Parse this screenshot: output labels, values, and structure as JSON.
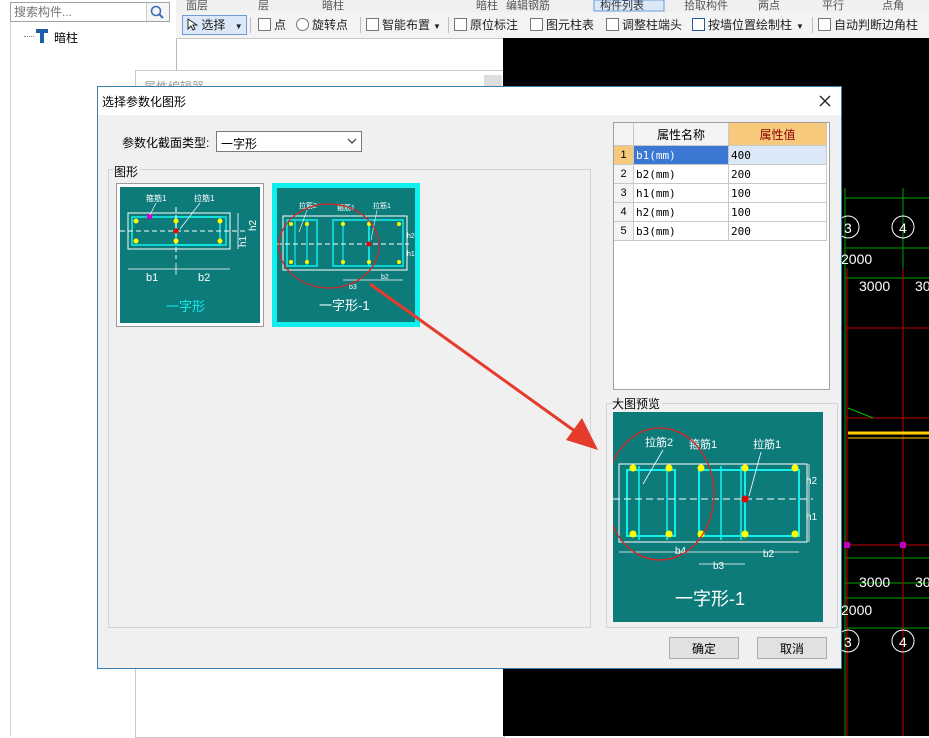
{
  "left_panel": {
    "search_placeholder": "搜索构件...",
    "tree_item": "暗柱",
    "icons": {
      "search": "search-icon",
      "tree": "column-icon"
    }
  },
  "toolbar_top": [
    "面层",
    "层",
    "暗柱",
    "暗柱",
    "编辑钢筋",
    "构件列表",
    "拾取构件",
    "两点",
    "平行",
    "点角"
  ],
  "toolbar": {
    "select": "选择",
    "point": "点",
    "rotate_point": "旋转点",
    "smart_layout": "智能布置",
    "origin_annotate": "原位标注",
    "element_table": "图元柱表",
    "adjust_column_end": "调整柱端头",
    "draw_by_wall": "按墙位置绘制柱",
    "auto_corner": "自动判断边角柱"
  },
  "attr_editor": {
    "title": "属性编辑器"
  },
  "dialog": {
    "title": "选择参数化图形",
    "section_type_label": "参数化截面类型:",
    "section_type_value": "一字形",
    "shapes_label": "图形",
    "preview_label": "大图预览",
    "ok": "确定",
    "cancel": "取消",
    "thumbnails": [
      {
        "name": "一字形",
        "labels": {
          "stirrup": "箍筋1",
          "tie": "拉筋1",
          "b1": "b1",
          "b2": "b2",
          "h1": "h1",
          "h2": "h2"
        }
      },
      {
        "name": "一字形-1",
        "labels": {
          "tie2": "拉筋2",
          "stirrup": "箍筋1",
          "tie": "拉筋1",
          "b3": "b3",
          "b2": "b2",
          "h1": "h1",
          "h2": "h2"
        }
      }
    ],
    "preview": {
      "name": "一字形-1",
      "labels": {
        "tie2": "拉筋2",
        "stirrup": "箍筋1",
        "tie": "拉筋1",
        "b3": "b3",
        "b2": "b2",
        "h1": "h1",
        "h2": "h2",
        "b4": "b4"
      }
    },
    "table": {
      "headers": [
        "属性名称",
        "属性值"
      ],
      "rows": [
        {
          "index": "1",
          "name": "b1(mm)",
          "value": "400"
        },
        {
          "index": "2",
          "name": "b2(mm)",
          "value": "200"
        },
        {
          "index": "3",
          "name": "h1(mm)",
          "value": "100"
        },
        {
          "index": "4",
          "name": "h2(mm)",
          "value": "100"
        },
        {
          "index": "5",
          "name": "b3(mm)",
          "value": "200"
        }
      ]
    }
  },
  "cad": {
    "axis_labels": [
      "3",
      "4",
      "3",
      "4"
    ],
    "dimensions": [
      "2000",
      "3000",
      "30",
      "3000",
      "30",
      "2000"
    ],
    "colors": {
      "background": "#000000",
      "grid_green": "#00a000",
      "grid_red": "#c00000",
      "yellow": "#ffd000"
    }
  },
  "colors": {
    "teal": "#0e7b7b",
    "cyan_bar": "#1eeeee",
    "header_orange": "#f7c97c",
    "selection_blue": "#3a78d4",
    "dialog_border": "#3c7fb1"
  }
}
